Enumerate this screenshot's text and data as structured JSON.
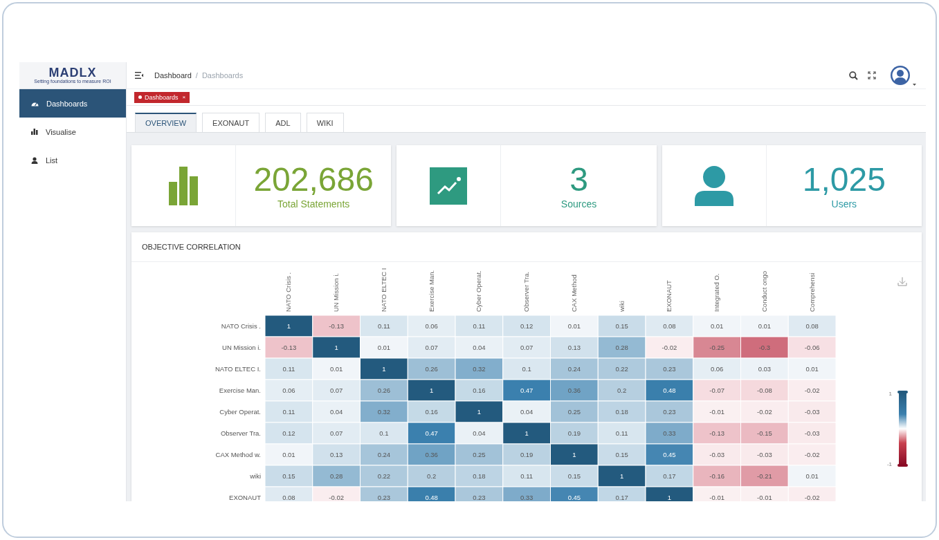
{
  "sidebar": {
    "logo": {
      "name": "MADLX",
      "tagline": "Setting foundations to measure ROI"
    },
    "items": [
      {
        "label": "Dashboards",
        "kind": "gauge",
        "selected": true
      },
      {
        "label": "Visualise",
        "kind": "bars",
        "selected": false
      },
      {
        "label": "List",
        "kind": "person",
        "selected": false
      }
    ]
  },
  "header": {
    "breadcrumb": [
      "Dashboard",
      "Dashboards"
    ],
    "separator": "/"
  },
  "tag": {
    "label": "Dashboards",
    "close": "×"
  },
  "tabs": [
    {
      "label": "OVERVIEW",
      "selected": true
    },
    {
      "label": "EXONAUT",
      "selected": false
    },
    {
      "label": "ADL",
      "selected": false
    },
    {
      "label": "WIKI",
      "selected": false
    }
  ],
  "stats": [
    {
      "kind": "bars",
      "value": "202,686",
      "label": "Total Statements",
      "color": "#7aa536"
    },
    {
      "kind": "trend",
      "value": "3",
      "label": "Sources",
      "color": "#2e9a80"
    },
    {
      "kind": "user",
      "value": "1,025",
      "label": "Users",
      "color": "#2d9aa5"
    }
  ],
  "correlation": {
    "title": "OBJECTIVE CORRELATION",
    "columns": [
      "NATO Crisis .",
      "UN Mission i.",
      "NATO ELTEC I",
      "Exercise Man.",
      "Cyber Operat.",
      "Observer Tra.",
      "CAX Method",
      "wiki",
      "EXONAUT",
      "Integrated O.",
      "Conduct ongo",
      "Comprehensi"
    ],
    "rows": [
      {
        "label": "NATO Crisis .",
        "cells": [
          "1",
          "-0.13",
          "0.11",
          "0.06",
          "0.11",
          "0.12",
          "0.01",
          "0.15",
          "0.08",
          "0.01",
          "0.01",
          "0.08"
        ]
      },
      {
        "label": "UN Mission i.",
        "cells": [
          "-0.13",
          "1",
          "0.01",
          "0.07",
          "0.04",
          "0.07",
          "0.13",
          "0.28",
          "-0.02",
          "-0.25",
          "-0.3",
          "-0.06"
        ]
      },
      {
        "label": "NATO ELTEC I.",
        "cells": [
          "0.11",
          "0.01",
          "1",
          "0.26",
          "0.32",
          "0.1",
          "0.24",
          "0.22",
          "0.23",
          "0.06",
          "0.03",
          "0.01"
        ]
      },
      {
        "label": "Exercise Man.",
        "cells": [
          "0.06",
          "0.07",
          "0.26",
          "1",
          "0.16",
          "0.47",
          "0.36",
          "0.2",
          "0.48",
          "-0.07",
          "-0.08",
          "-0.02"
        ]
      },
      {
        "label": "Cyber Operat.",
        "cells": [
          "0.11",
          "0.04",
          "0.32",
          "0.16",
          "1",
          "0.04",
          "0.25",
          "0.18",
          "0.23",
          "-0.01",
          "-0.02",
          "-0.03"
        ]
      },
      {
        "label": "Observer Tra.",
        "cells": [
          "0.12",
          "0.07",
          "0.1",
          "0.47",
          "0.04",
          "1",
          "0.19",
          "0.11",
          "0.33",
          "-0.13",
          "-0.15",
          "-0.03"
        ]
      },
      {
        "label": "CAX Method w.",
        "cells": [
          "0.01",
          "0.13",
          "0.24",
          "0.36",
          "0.25",
          "0.19",
          "1",
          "0.15",
          "0.45",
          "-0.03",
          "-0.03",
          "-0.02"
        ]
      },
      {
        "label": "wiki",
        "cells": [
          "0.15",
          "0.28",
          "0.22",
          "0.2",
          "0.18",
          "0.11",
          "0.15",
          "1",
          "0.17",
          "-0.16",
          "-0.21",
          "0.01"
        ]
      },
      {
        "label": "EXONAUT",
        "cells": [
          "0.08",
          "-0.02",
          "0.23",
          "0.48",
          "0.23",
          "0.33",
          "0.45",
          "0.17",
          "1",
          "-0.01",
          "-0.01",
          "-0.02"
        ]
      }
    ],
    "legend": {
      "max_label": "1",
      "min_label": "-1"
    }
  }
}
